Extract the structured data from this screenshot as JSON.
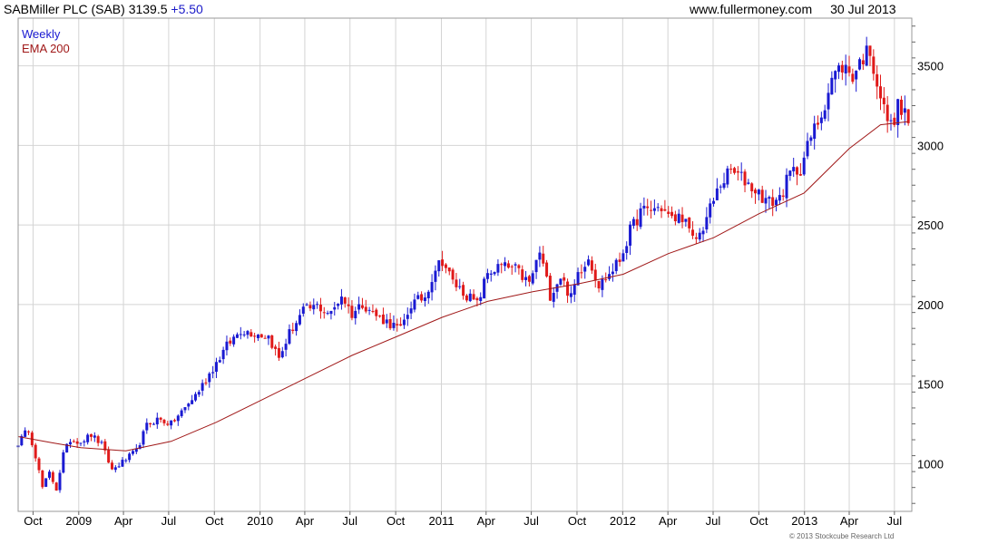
{
  "header": {
    "title": "SABMiller PLC (SAB) 3139.5",
    "change": "+5.50",
    "website": "www.fullermoney.com",
    "date": "30 Jul 2013"
  },
  "legend": {
    "period": "Weekly",
    "ema": "EMA 200"
  },
  "copyright": "© 2013 Stockcube Research Ltd",
  "colors": {
    "up": "#1a1ad2",
    "down": "#e01a1a",
    "ema": "#a01818",
    "grid": "#d4d4d4",
    "frame": "#9a9a9a"
  },
  "chart_data": {
    "type": "candlestick",
    "title": "SABMiller PLC (SAB)",
    "interval": "weekly",
    "ylim": [
      700,
      3800
    ],
    "y_ticks": [
      1000,
      1500,
      2000,
      2500,
      3000,
      3500
    ],
    "x_ticks": [
      {
        "label": "Oct",
        "date": "2008-10-01"
      },
      {
        "label": "2009",
        "date": "2009-01-01"
      },
      {
        "label": "Apr",
        "date": "2009-04-01"
      },
      {
        "label": "Jul",
        "date": "2009-07-01"
      },
      {
        "label": "Oct",
        "date": "2009-10-01"
      },
      {
        "label": "2010",
        "date": "2010-01-01"
      },
      {
        "label": "Apr",
        "date": "2010-04-01"
      },
      {
        "label": "Jul",
        "date": "2010-07-01"
      },
      {
        "label": "Oct",
        "date": "2010-10-01"
      },
      {
        "label": "2011",
        "date": "2011-01-01"
      },
      {
        "label": "Apr",
        "date": "2011-04-01"
      },
      {
        "label": "Jul",
        "date": "2011-07-01"
      },
      {
        "label": "Oct",
        "date": "2011-10-01"
      },
      {
        "label": "2012",
        "date": "2012-01-01"
      },
      {
        "label": "Apr",
        "date": "2012-04-01"
      },
      {
        "label": "Jul",
        "date": "2012-07-01"
      },
      {
        "label": "Oct",
        "date": "2012-10-01"
      },
      {
        "label": "2013",
        "date": "2013-01-01"
      },
      {
        "label": "Apr",
        "date": "2013-04-01"
      },
      {
        "label": "Jul",
        "date": "2013-07-01"
      }
    ],
    "date_range": [
      "2008-09-01",
      "2013-08-05"
    ],
    "grid": true,
    "price_anchors": [
      [
        "2008-09-01",
        1130
      ],
      [
        "2008-09-22",
        1220
      ],
      [
        "2008-10-06",
        1050
      ],
      [
        "2008-10-20",
        850
      ],
      [
        "2008-11-03",
        940
      ],
      [
        "2008-11-17",
        840
      ],
      [
        "2008-12-01",
        1060
      ],
      [
        "2008-12-15",
        1150
      ],
      [
        "2009-01-05",
        1140
      ],
      [
        "2009-01-26",
        1180
      ],
      [
        "2009-02-16",
        1120
      ],
      [
        "2009-03-09",
        960
      ],
      [
        "2009-03-30",
        1010
      ],
      [
        "2009-04-27",
        1080
      ],
      [
        "2009-05-18",
        1240
      ],
      [
        "2009-06-08",
        1280
      ],
      [
        "2009-07-06",
        1250
      ],
      [
        "2009-08-03",
        1350
      ],
      [
        "2009-08-31",
        1460
      ],
      [
        "2009-09-28",
        1600
      ],
      [
        "2009-10-26",
        1740
      ],
      [
        "2009-11-23",
        1840
      ],
      [
        "2009-12-21",
        1820
      ],
      [
        "2010-01-18",
        1800
      ],
      [
        "2010-02-08",
        1660
      ],
      [
        "2010-03-01",
        1820
      ],
      [
        "2010-03-29",
        1960
      ],
      [
        "2010-04-26",
        1990
      ],
      [
        "2010-05-24",
        1940
      ],
      [
        "2010-06-14",
        2060
      ],
      [
        "2010-07-05",
        1940
      ],
      [
        "2010-07-26",
        2010
      ],
      [
        "2010-08-23",
        1930
      ],
      [
        "2010-09-20",
        1880
      ],
      [
        "2010-10-11",
        1840
      ],
      [
        "2010-11-01",
        2000
      ],
      [
        "2010-11-29",
        2050
      ],
      [
        "2010-12-20",
        2230
      ],
      [
        "2011-01-03",
        2280
      ],
      [
        "2011-01-24",
        2140
      ],
      [
        "2011-02-21",
        2060
      ],
      [
        "2011-03-14",
        2000
      ],
      [
        "2011-04-04",
        2200
      ],
      [
        "2011-05-02",
        2240
      ],
      [
        "2011-05-30",
        2220
      ],
      [
        "2011-06-27",
        2130
      ],
      [
        "2011-07-18",
        2330
      ],
      [
        "2011-08-08",
        2060
      ],
      [
        "2011-08-29",
        2180
      ],
      [
        "2011-09-19",
        2040
      ],
      [
        "2011-10-03",
        2200
      ],
      [
        "2011-10-24",
        2300
      ],
      [
        "2011-11-14",
        2120
      ],
      [
        "2011-12-05",
        2190
      ],
      [
        "2011-12-26",
        2280
      ],
      [
        "2012-01-16",
        2460
      ],
      [
        "2012-02-06",
        2580
      ],
      [
        "2012-02-27",
        2600
      ],
      [
        "2012-03-19",
        2610
      ],
      [
        "2012-04-09",
        2530
      ],
      [
        "2012-04-30",
        2560
      ],
      [
        "2012-05-21",
        2400
      ],
      [
        "2012-06-04",
        2440
      ],
      [
        "2012-06-25",
        2600
      ],
      [
        "2012-07-16",
        2760
      ],
      [
        "2012-08-06",
        2840
      ],
      [
        "2012-09-03",
        2780
      ],
      [
        "2012-10-01",
        2700
      ],
      [
        "2012-10-22",
        2640
      ],
      [
        "2012-11-12",
        2670
      ],
      [
        "2012-12-03",
        2820
      ],
      [
        "2012-12-24",
        2860
      ],
      [
        "2013-01-14",
        3050
      ],
      [
        "2013-02-04",
        3200
      ],
      [
        "2013-02-25",
        3420
      ],
      [
        "2013-03-18",
        3500
      ],
      [
        "2013-04-08",
        3440
      ],
      [
        "2013-04-29",
        3560
      ],
      [
        "2013-05-13",
        3600
      ],
      [
        "2013-05-27",
        3400
      ],
      [
        "2013-06-10",
        3220
      ],
      [
        "2013-06-24",
        3120
      ],
      [
        "2013-07-08",
        3240
      ],
      [
        "2013-07-22",
        3200
      ],
      [
        "2013-07-29",
        3139.5
      ]
    ],
    "ema200_anchors": [
      [
        "2008-09-01",
        1170
      ],
      [
        "2008-11-10",
        1130
      ],
      [
        "2009-01-05",
        1100
      ],
      [
        "2009-04-06",
        1080
      ],
      [
        "2009-07-06",
        1140
      ],
      [
        "2009-10-05",
        1260
      ],
      [
        "2010-01-04",
        1400
      ],
      [
        "2010-04-05",
        1540
      ],
      [
        "2010-07-05",
        1680
      ],
      [
        "2010-10-04",
        1800
      ],
      [
        "2011-01-03",
        1920
      ],
      [
        "2011-04-04",
        2020
      ],
      [
        "2011-07-04",
        2080
      ],
      [
        "2011-10-03",
        2130
      ],
      [
        "2012-01-02",
        2190
      ],
      [
        "2012-04-02",
        2320
      ],
      [
        "2012-07-02",
        2420
      ],
      [
        "2012-10-01",
        2570
      ],
      [
        "2012-12-31",
        2700
      ],
      [
        "2013-04-01",
        2980
      ],
      [
        "2013-06-03",
        3130
      ],
      [
        "2013-07-29",
        3150
      ]
    ]
  }
}
